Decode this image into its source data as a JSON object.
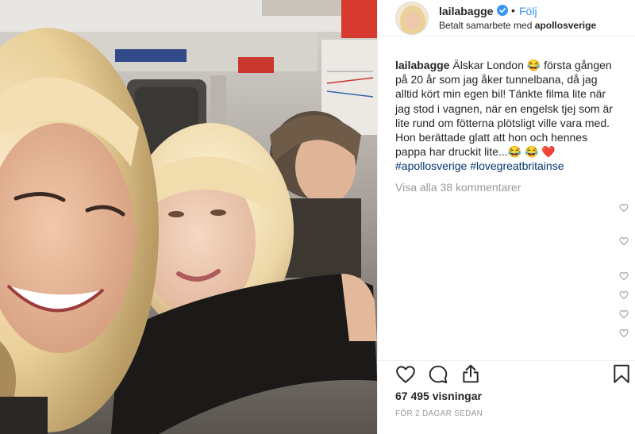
{
  "post": {
    "username": "lailabagge",
    "follow_label": "Följ",
    "separator": "•",
    "paid_prefix": "Betalt samarbete med",
    "paid_partner": "apollosverige",
    "caption_user": "lailabagge",
    "caption_line1": " Älskar London 😂  första gången",
    "caption_line2": "på 20 år som jag åker tunnelbana, då jag",
    "caption_line3": "alltid kört min egen bil! Tänkte filma lite när",
    "caption_line4": "jag stod i vagnen, när en engelsk tjej som är",
    "caption_line5": "lite rund om fötterna plötsligt ville vara med.",
    "caption_line6": "Hon berättade glatt att hon och hennes",
    "caption_line7_text": "pappa har druckit lite...😂 😂 ",
    "caption_line7_heart": "❤️",
    "hashtag1": "#apollosverige",
    "hashtag2": "#lovegreatbritainse",
    "view_comments": "Visa alla 38 kommentarer",
    "views": "67 495 visningar",
    "date": "FÖR 2 DAGAR SEDAN"
  },
  "icons": {
    "verified": "verified-badge-icon",
    "like": "heart-outline-icon",
    "comment": "speech-bubble-icon",
    "share": "share-upload-icon",
    "save": "bookmark-icon",
    "comment_like": "small-heart-icon"
  },
  "colors": {
    "link_blue": "#3897f0",
    "hashtag": "#003569",
    "muted": "#999999",
    "text": "#262626"
  }
}
